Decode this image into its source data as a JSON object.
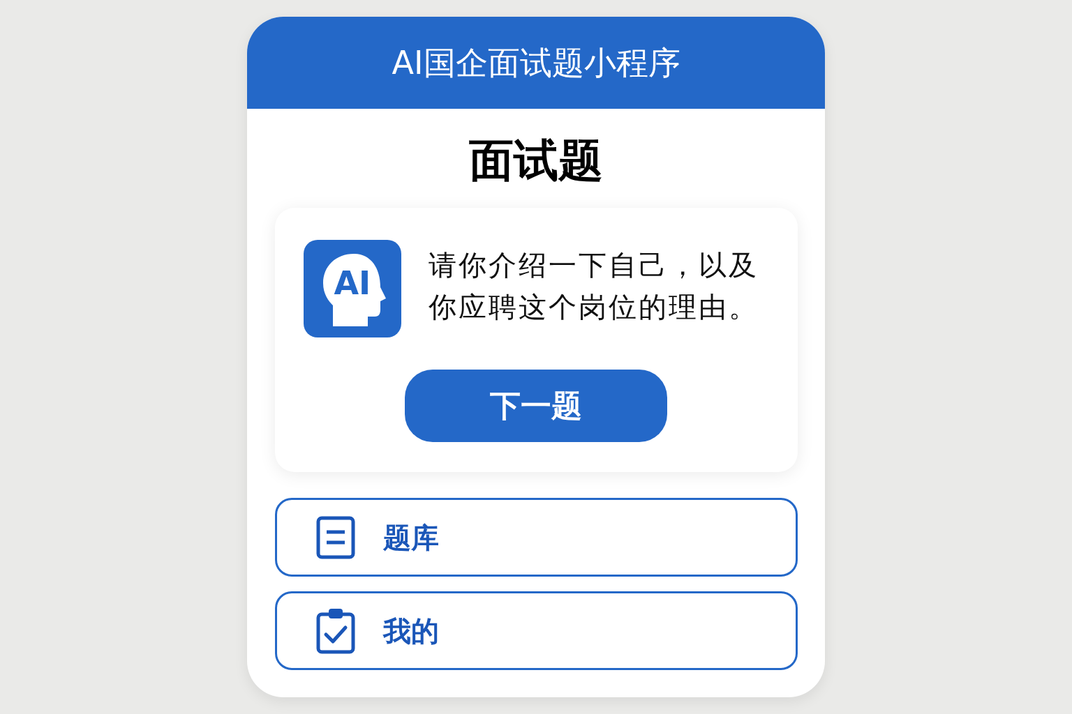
{
  "header": {
    "title": "AI国企面试题小程序"
  },
  "heading": "面试题",
  "question_card": {
    "logo_text": "AI",
    "question": "请你介绍一下自己，以及你应聘这个岗位的理由。",
    "button": "下一题"
  },
  "nav_items": [
    {
      "label": "题库",
      "kind": "list"
    },
    {
      "label": "我的",
      "kind": "clipboard"
    }
  ]
}
